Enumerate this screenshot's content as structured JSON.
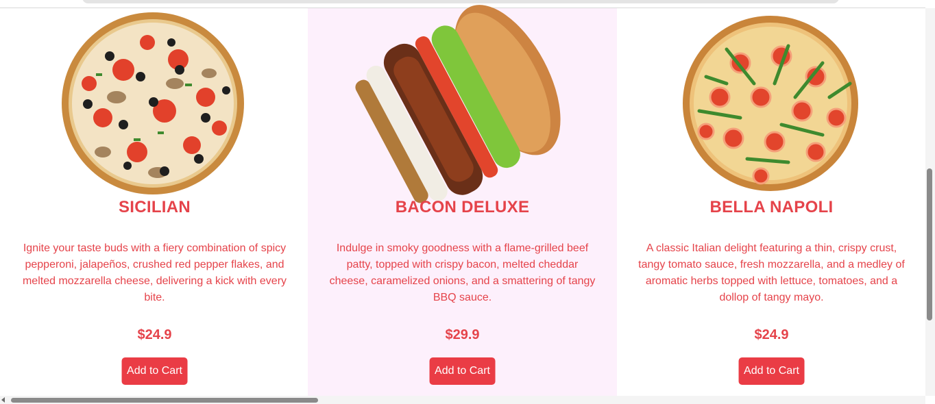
{
  "products": [
    {
      "name": "SICILIAN",
      "description": "Ignite your taste buds with a fiery combination of spicy pepperoni, jalapeños, crushed red pepper flakes, and melted mozzarella cheese, delivering a kick with every bite.",
      "price": "$24.9",
      "button_label": "Add to Cart",
      "image": "pizza-pepper-olive-image"
    },
    {
      "name": "BACON DELUXE",
      "description": "Indulge in smoky goodness with a flame-grilled beef patty, topped with crispy bacon, melted cheddar cheese, caramelized onions, and a smattering of tangy BBQ sauce.",
      "price": "$29.9",
      "button_label": "Add to Cart",
      "image": "bacon-burger-image"
    },
    {
      "name": "BELLA NAPOLI",
      "description": "A classic Italian delight featuring a thin, crispy crust, tangy tomato sauce, fresh mozzarella, and a medley of aromatic herbs topped with lettuce, tomatoes, and a dollop of tangy mayo.",
      "price": "$24.9",
      "button_label": "Add to Cart",
      "image": "pizza-tomato-arugula-image"
    }
  ],
  "colors": {
    "accent": "#e5434a",
    "button": "#ea3c45",
    "highlight_card_bg": "#fdf0fc"
  }
}
